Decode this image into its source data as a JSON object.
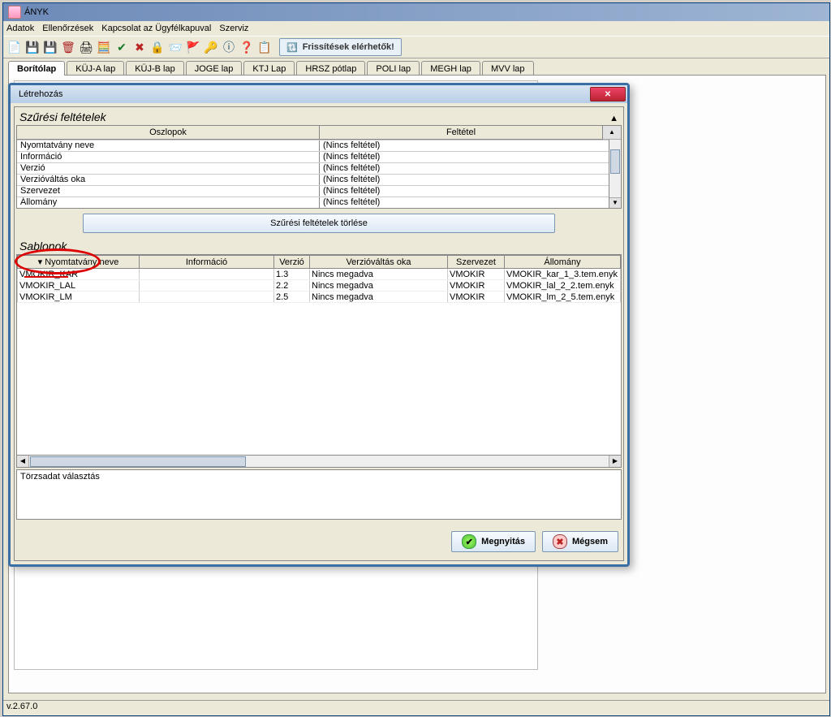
{
  "app": {
    "title": "ÁNYK"
  },
  "menu": {
    "items": [
      "Adatok",
      "Ellenőrzések",
      "Kapcsolat az Ügyfélkapuval",
      "Szerviz"
    ]
  },
  "toolbar": {
    "updates_label": "Frissítések elérhetők!"
  },
  "tabs": [
    "Borítólap",
    "KÜJ-A lap",
    "KÜJ-B lap",
    "JOGE lap",
    "KTJ Lap",
    "HRSZ pótlap",
    "POLI lap",
    "MEGH lap",
    "MVV lap"
  ],
  "status": {
    "version": "v.2.67.0"
  },
  "dialog": {
    "title": "Létrehozás",
    "filter_section_title": "Szűrési feltételek",
    "filter_columns_header": "Oszlopok",
    "filter_condition_header": "Feltétel",
    "filter_rows": [
      {
        "col": "Nyomtatvány neve",
        "cond": "(Nincs feltétel)"
      },
      {
        "col": "Információ",
        "cond": "(Nincs feltétel)"
      },
      {
        "col": "Verzió",
        "cond": "(Nincs feltétel)"
      },
      {
        "col": "Verzióváltás oka",
        "cond": "(Nincs feltétel)"
      },
      {
        "col": "Szervezet",
        "cond": "(Nincs feltétel)"
      },
      {
        "col": "Állomány",
        "cond": "(Nincs feltétel)"
      }
    ],
    "clear_filters_label": "Szűrési feltételek törlése",
    "templates_section_title": "Sablonok",
    "templates_headers": [
      "Nyomtatvány neve",
      "Információ",
      "Verzió",
      "Verzióváltás oka",
      "Szervezet",
      "Állomány"
    ],
    "templates_rows": [
      {
        "name": "VMOKIR_KAR",
        "info": "",
        "ver": "1.3",
        "reason": "Nincs megadva",
        "org": "VMOKIR",
        "file": "VMOKIR_kar_1_3.tem.enyk"
      },
      {
        "name": "VMOKIR_LAL",
        "info": "",
        "ver": "2.2",
        "reason": "Nincs megadva",
        "org": "VMOKIR",
        "file": "VMOKIR_lal_2_2.tem.enyk"
      },
      {
        "name": "VMOKIR_LM",
        "info": "",
        "ver": "2.5",
        "reason": "Nincs megadva",
        "org": "VMOKIR",
        "file": "VMOKIR_lm_2_5.tem.enyk"
      }
    ],
    "torzsadat_label": "Törzsadat választás",
    "open_button": "Megnyitás",
    "cancel_button": "Mégsem"
  }
}
